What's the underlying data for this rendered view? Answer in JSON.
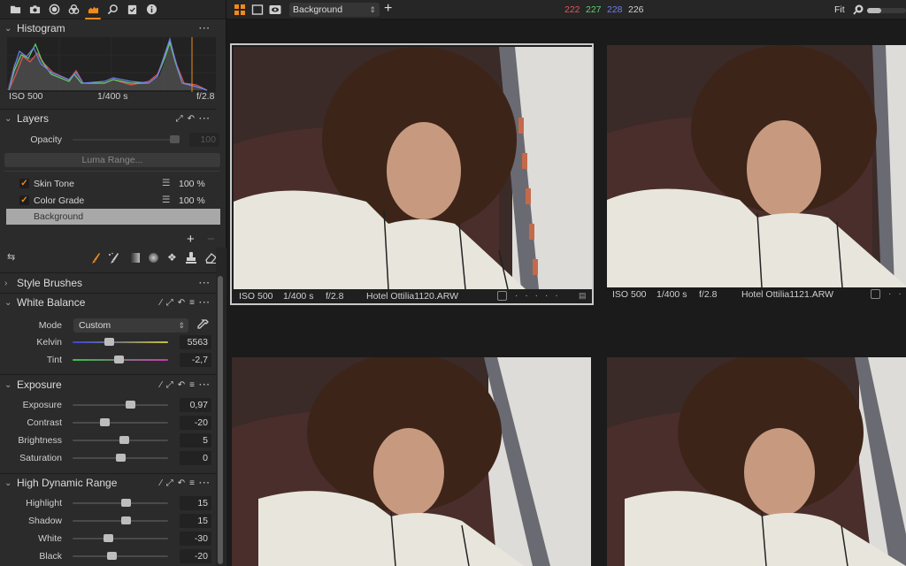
{
  "sidebar": {
    "tool_tabs": [
      {
        "icon": "folder-icon",
        "label": "Library"
      },
      {
        "icon": "camera-icon",
        "label": "Capture"
      },
      {
        "icon": "lens-icon",
        "label": "Lens"
      },
      {
        "icon": "color-icon",
        "label": "Color"
      },
      {
        "icon": "exposure-icon",
        "label": "Exposure",
        "active": true
      },
      {
        "icon": "details-icon",
        "label": "Details"
      },
      {
        "icon": "adjustments-icon",
        "label": "Adjustments"
      },
      {
        "icon": "metadata-icon",
        "label": "Metadata"
      }
    ],
    "histogram": {
      "title": "Histogram",
      "iso": "ISO 500",
      "shutter": "1/400 s",
      "aperture": "f/2.8"
    },
    "layers": {
      "title": "Layers",
      "opacity_label": "Opacity",
      "opacity_value": "100",
      "opacity_fraction": 1.0,
      "luma_range_label": "Luma Range...",
      "items": [
        {
          "name": "Skin Tone",
          "checked": true,
          "opacity": "100 %"
        },
        {
          "name": "Color Grade",
          "checked": true,
          "opacity": "100 %"
        },
        {
          "name": "Background",
          "selected": true
        }
      ]
    },
    "tools": [
      "brush-icon",
      "magic-brush-icon",
      "linear-gradient-icon",
      "radial-gradient-icon",
      "heal-icon",
      "clone-stamp-icon",
      "eraser-icon"
    ],
    "style_brushes": {
      "title": "Style Brushes"
    },
    "white_balance": {
      "title": "White Balance",
      "mode_label": "Mode",
      "mode_value": "Custom",
      "sliders": [
        {
          "label": "Kelvin",
          "value": "5563",
          "position": 0.38
        },
        {
          "label": "Tint",
          "value": "-2,7",
          "position": 0.48
        }
      ]
    },
    "exposure": {
      "title": "Exposure",
      "sliders": [
        {
          "label": "Exposure",
          "value": "0,97",
          "position": 0.6
        },
        {
          "label": "Contrast",
          "value": "-20",
          "position": 0.33
        },
        {
          "label": "Brightness",
          "value": "5",
          "position": 0.54
        },
        {
          "label": "Saturation",
          "value": "0",
          "position": 0.5
        }
      ]
    },
    "hdr": {
      "title": "High Dynamic Range",
      "sliders": [
        {
          "label": "Highlight",
          "value": "15",
          "position": 0.56
        },
        {
          "label": "Shadow",
          "value": "15",
          "position": 0.56
        },
        {
          "label": "White",
          "value": "-30",
          "position": 0.37
        },
        {
          "label": "Black",
          "value": "-20",
          "position": 0.41
        }
      ]
    }
  },
  "topbar": {
    "variant_select": "Background",
    "rgb": {
      "r": "222",
      "g": "227",
      "b": "228",
      "l": "226"
    },
    "zoom_label": "Fit",
    "colors": {
      "r": "#e0555a",
      "g": "#5fd26a",
      "b": "#6f7fe8",
      "l": "#d0d0d0"
    }
  },
  "viewer": {
    "images": [
      {
        "iso": "ISO 500",
        "shutter": "1/400 s",
        "aperture": "f/2.8",
        "filename": "Hotel Ottilia1120.ARW",
        "selected": true
      },
      {
        "iso": "ISO 500",
        "shutter": "1/400 s",
        "aperture": "f/2.8",
        "filename": "Hotel Ottilia1121.ARW",
        "selected": false
      },
      {
        "filename": "",
        "selected": false
      },
      {
        "filename": "",
        "selected": false
      }
    ]
  },
  "accent": "#f08a1c"
}
